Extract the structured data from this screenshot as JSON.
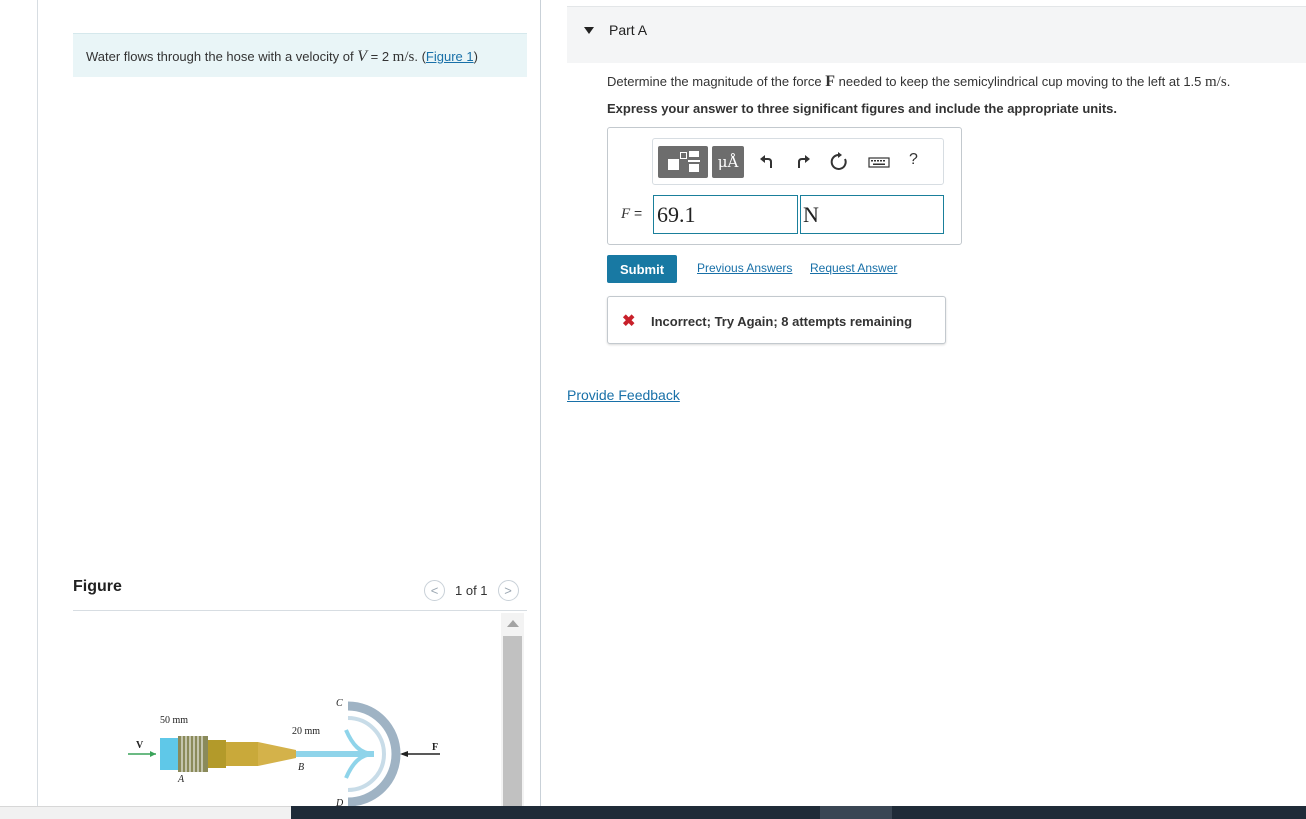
{
  "problem": {
    "text_before": "Water flows through the hose with a velocity of ",
    "var": "V",
    "equals": " = 2 ",
    "unit": "m/s",
    "text_after": ". (",
    "figure_link": "Figure 1",
    "close": ")"
  },
  "figure": {
    "title": "Figure",
    "counter": "1 of 1",
    "prev_glyph": "<",
    "next_glyph": ">",
    "labels": {
      "dim1": "50 mm",
      "dim2": "20 mm",
      "v": "V",
      "a": "A",
      "b": "B",
      "c": "C",
      "d": "D",
      "f": "F"
    }
  },
  "part": {
    "title": "Part A"
  },
  "question": {
    "text_before": "Determine the magnitude of the force ",
    "force_var": "F",
    "text_after": " needed to keep the semicylindrical cup moving to the left at 1.5 ",
    "unit": "m/s",
    "period": "."
  },
  "instruction": "Express your answer to three significant figures and include the appropriate units.",
  "toolbar": {
    "unit_button": "μÅ",
    "help": "?"
  },
  "answer": {
    "label": "F",
    "equals": " =",
    "value": "69.1",
    "unit": "N"
  },
  "actions": {
    "submit": "Submit",
    "previous_answers": "Previous Answers",
    "request_answer": "Request Answer"
  },
  "feedback": {
    "icon": "✖",
    "message": "Incorrect; Try Again; 8 attempts remaining"
  },
  "provide_feedback": "Provide Feedback",
  "colors": {
    "accent": "#1879a3",
    "link": "#1870a8",
    "error": "#c8202a",
    "problem_bg": "#e9f5f7"
  }
}
